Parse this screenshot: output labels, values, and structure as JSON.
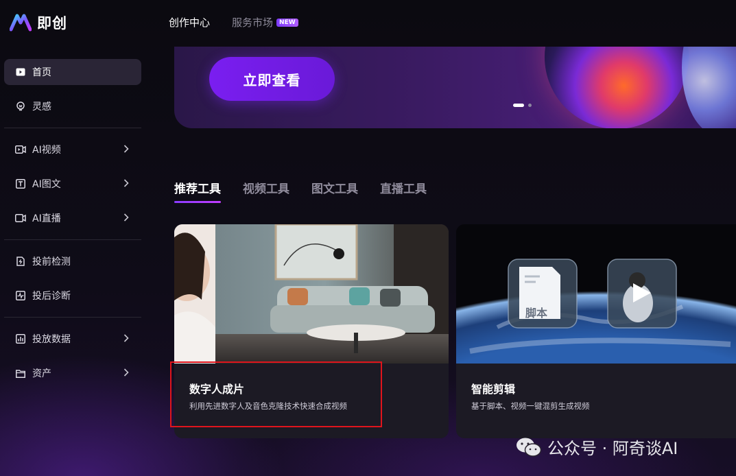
{
  "app": {
    "name": "即创"
  },
  "topnav": {
    "items": [
      {
        "label": "创作中心",
        "active": true
      },
      {
        "label": "服务市场",
        "badge": "NEW"
      }
    ]
  },
  "sidebar": {
    "items": [
      {
        "label": "首页",
        "icon": "home-play-icon",
        "active": true
      },
      {
        "label": "灵感",
        "icon": "bulb-icon"
      },
      {
        "label": "AI视频",
        "icon": "video-icon",
        "chevron": true
      },
      {
        "label": "AI图文",
        "icon": "text-image-icon",
        "chevron": true
      },
      {
        "label": "AI直播",
        "icon": "live-icon",
        "chevron": true
      },
      {
        "label": "投前检测",
        "icon": "document-check-icon"
      },
      {
        "label": "投后诊断",
        "icon": "pulse-icon"
      },
      {
        "label": "投放数据",
        "icon": "bar-chart-icon",
        "chevron": true
      },
      {
        "label": "资产",
        "icon": "folder-icon",
        "chevron": true
      }
    ]
  },
  "banner": {
    "cta_label": "立即查看",
    "carousel_pages": 2,
    "carousel_current": 1
  },
  "tabs": [
    {
      "label": "推荐工具",
      "active": true
    },
    {
      "label": "视频工具"
    },
    {
      "label": "图文工具"
    },
    {
      "label": "直播工具"
    }
  ],
  "cards": [
    {
      "title": "数字人成片",
      "desc": "利用先进数字人及音色克隆技术快速合成视频",
      "highlighted": true
    },
    {
      "title": "智能剪辑",
      "desc": "基于脚本、视频一键混剪生成视频",
      "script_label": "脚本"
    }
  ],
  "watermark": {
    "text": "公众号 · 阿奇谈AI"
  },
  "colors": {
    "accent": "#7a1ef0",
    "highlight_border": "#e0141c",
    "background": "#0d0b14"
  }
}
